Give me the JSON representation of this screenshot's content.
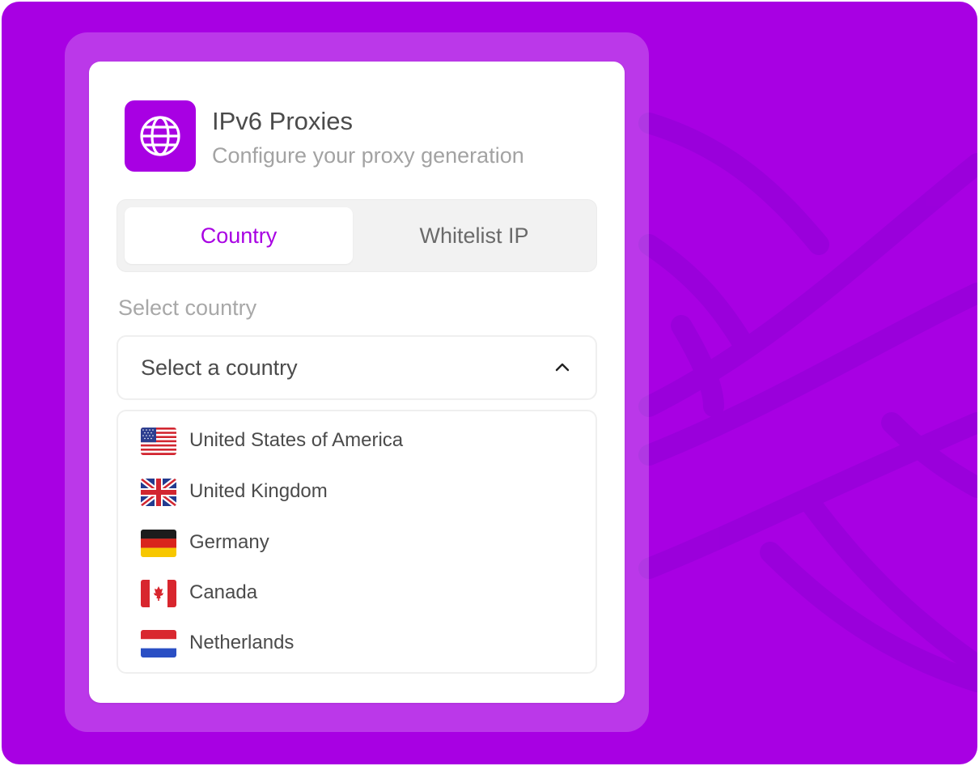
{
  "card": {
    "title": "IPv6 Proxies",
    "subtitle": "Configure your proxy generation",
    "icon": "globe-icon"
  },
  "tabs": [
    {
      "label": "Country",
      "active": true
    },
    {
      "label": "Whitelist IP",
      "active": false
    }
  ],
  "country_field": {
    "label": "Select country",
    "placeholder": "Select a country",
    "expanded": true,
    "chevron_icon": "chevron-up-icon"
  },
  "countries": [
    {
      "name": "United States of America",
      "flag": "us-flag-icon"
    },
    {
      "name": "United Kingdom",
      "flag": "uk-flag-icon"
    },
    {
      "name": "Germany",
      "flag": "germany-flag-icon"
    },
    {
      "name": "Canada",
      "flag": "canada-flag-icon"
    },
    {
      "name": "Netherlands",
      "flag": "netherlands-flag-icon"
    }
  ],
  "colors": {
    "accent": "#a800e3",
    "text": "#4b4b4b",
    "muted": "#a8a8a8"
  }
}
